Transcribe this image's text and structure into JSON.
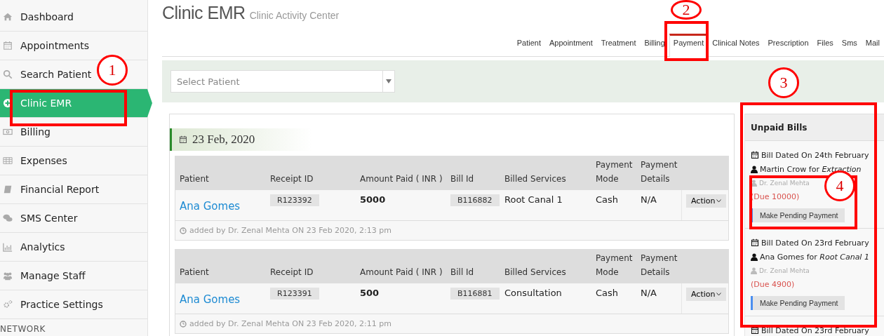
{
  "sidebar": {
    "items": [
      {
        "label": "Dashboard",
        "selected": false
      },
      {
        "label": "Appointments",
        "selected": false
      },
      {
        "label": "Search Patient",
        "selected": false
      },
      {
        "label": "Clinic EMR",
        "selected": true
      },
      {
        "label": "Billing",
        "selected": false
      },
      {
        "label": "Expenses",
        "selected": false
      },
      {
        "label": "Financial Report",
        "selected": false
      },
      {
        "label": "SMS Center",
        "selected": false
      },
      {
        "label": "Analytics",
        "selected": false
      },
      {
        "label": "Manage Staff",
        "selected": false
      },
      {
        "label": "Practice Settings",
        "selected": false
      }
    ],
    "section": "NETWORK"
  },
  "page": {
    "title": "Clinic EMR",
    "subtitle": "Clinic Activity Center"
  },
  "tabs": [
    {
      "label": "Patient",
      "selected": false
    },
    {
      "label": "Appointment",
      "selected": false
    },
    {
      "label": "Treatment",
      "selected": false
    },
    {
      "label": "Billing",
      "selected": false
    },
    {
      "label": "Payment",
      "selected": true
    },
    {
      "label": "Clinical Notes",
      "selected": false
    },
    {
      "label": "Prescription",
      "selected": false
    },
    {
      "label": "Files",
      "selected": false
    },
    {
      "label": "Sms",
      "selected": false
    },
    {
      "label": "Mail",
      "selected": false
    }
  ],
  "patient_select": {
    "placeholder": "Select Patient"
  },
  "date_group": {
    "date": "23 Feb, 2020",
    "payments": [
      {
        "columns": [
          "Patient",
          "Receipt ID",
          "Amount Paid ( INR )",
          "Bill Id",
          "Billed Services",
          "Payment Mode",
          "Payment Details"
        ],
        "patient": "Ana Gomes",
        "receipt_id": "R123392",
        "amount": "5000",
        "bill_id": "B116882",
        "services": "Root Canal 1",
        "mode": "Cash",
        "details": "N/A",
        "action": "Action",
        "note": "added by Dr. Zenal Mehta ON 23 Feb 2020, 2:13 pm"
      },
      {
        "columns": [
          "Patient",
          "Receipt ID",
          "Amount Paid ( INR )",
          "Bill Id",
          "Billed Services",
          "Payment Mode",
          "Payment Details"
        ],
        "patient": "Ana Gomes",
        "receipt_id": "R123391",
        "amount": "500",
        "bill_id": "B116881",
        "services": "Consultation",
        "mode": "Cash",
        "details": "N/A",
        "action": "Action",
        "note": "added by Dr. Zenal Mehta ON 23 Feb 2020, 2:11 pm"
      }
    ]
  },
  "unpaid_bills": {
    "title": "Unpaid Bills",
    "bills": [
      {
        "date": "Bill Dated On 24th February",
        "patient": "Martin Crow for *Extraction*",
        "doctor": "Dr. Zenal Mehta",
        "due": "(Due 10000)",
        "button": "Make Pending Payment"
      },
      {
        "date": "Bill Dated On 23rd February",
        "patient": "Ana Gomes for *Root Canal 1*",
        "doctor": "Dr. Zenal Mehta",
        "due": "(Due 4900)",
        "button": "Make Pending Payment"
      },
      {
        "date": "Bill Dated On 23rd February"
      }
    ]
  },
  "annotations": [
    {
      "number": "1"
    },
    {
      "number": "2"
    },
    {
      "number": "3"
    },
    {
      "number": "4"
    }
  ]
}
